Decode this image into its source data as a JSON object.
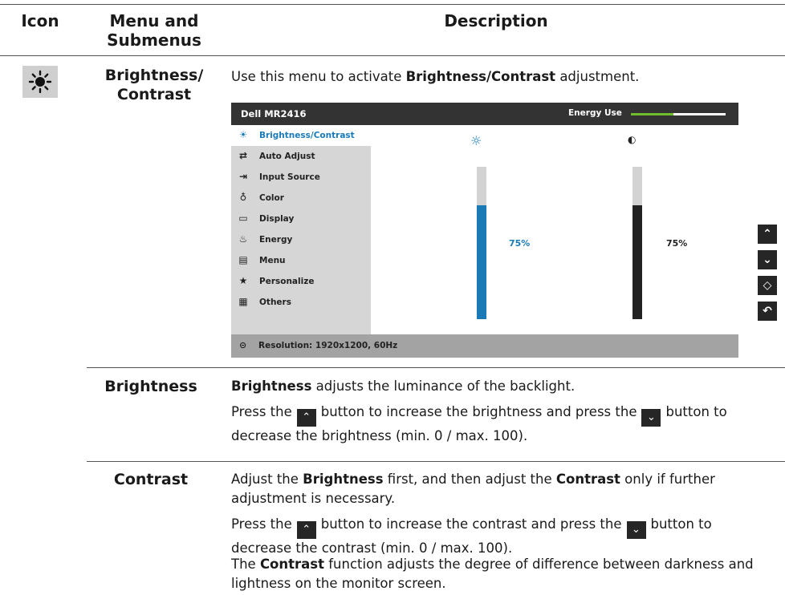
{
  "table": {
    "headers": {
      "icon": "Icon",
      "menu": "Menu and Submenus",
      "description": "Description"
    }
  },
  "brightness_contrast": {
    "menu_name": "Brightness/ Contrast",
    "intro_pre": "Use this menu to activate ",
    "intro_bold": "Brightness/Contrast",
    "intro_post": " adjustment.",
    "osd": {
      "title": "Dell MR2416",
      "energy_label": "Energy Use",
      "energy_level": 0.45,
      "energy_color": "#6ebd2b",
      "items": [
        {
          "icon": "☀",
          "icon_name": "brightness-icon",
          "label": "Brightness/Contrast",
          "active": true
        },
        {
          "icon": "⇄",
          "icon_name": "auto-adjust-icon",
          "label": "Auto Adjust"
        },
        {
          "icon": "⇥",
          "icon_name": "input-source-icon",
          "label": "Input Source"
        },
        {
          "icon": "♁",
          "icon_name": "color-icon",
          "label": "Color"
        },
        {
          "icon": "▭",
          "icon_name": "display-icon",
          "label": "Display"
        },
        {
          "icon": "♨",
          "icon_name": "energy-icon",
          "label": "Energy"
        },
        {
          "icon": "▤",
          "icon_name": "menu-icon",
          "label": "Menu"
        },
        {
          "icon": "★",
          "icon_name": "star-icon",
          "label": "Personalize"
        },
        {
          "icon": "▦",
          "icon_name": "others-icon",
          "label": "Others"
        }
      ],
      "brightness_value": "75%",
      "brightness_level": 0.75,
      "brightness_color": "#1a7ab8",
      "contrast_value": "75%",
      "contrast_level": 0.75,
      "contrast_color": "#222222",
      "brightness_glyph": "☼",
      "contrast_glyph": "◐",
      "status_glyph": "⊝",
      "resolution": "Resolution: 1920x1200, 60Hz"
    },
    "side_buttons": [
      {
        "glyph": "⌃",
        "name": "up-arrow-button"
      },
      {
        "glyph": "⌄",
        "name": "down-arrow-button"
      },
      {
        "glyph": "◇",
        "name": "ok-button"
      },
      {
        "glyph": "↶",
        "name": "back-button"
      }
    ]
  },
  "brightness": {
    "menu_name": "Brightness",
    "line1_bold": "Brightness",
    "line1_rest": " adjusts the luminance of the backlight.",
    "press_pre": "Press the",
    "press_mid": "button to increase the brightness and press the",
    "press_post": "button to decrease the brightness (min. 0 / max. 100)."
  },
  "contrast": {
    "menu_name": "Contrast",
    "p1_a": "Adjust the ",
    "p1_b": "Brightness",
    "p1_c": " first, and then adjust the ",
    "p1_d": "Contrast",
    "p1_e": " only if further adjustment is necessary.",
    "press_pre": "Press the",
    "press_mid": "button to increase the contrast and press the",
    "press_post": "button to decrease the contrast (min. 0 / max. 100).",
    "p3_a": "The ",
    "p3_b": "Contrast",
    "p3_c": " function adjusts the degree of difference between darkness and lightness on the monitor screen."
  }
}
